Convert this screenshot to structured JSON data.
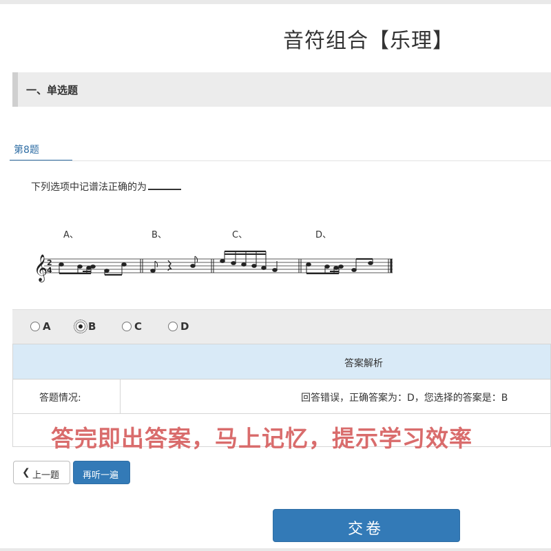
{
  "page": {
    "title": "音符组合【乐理】"
  },
  "section": {
    "title": "一、单选题"
  },
  "question": {
    "tab_label": "第8题",
    "text": "下列选项中记谱法正确的为",
    "option_labels": [
      "A、",
      "B、",
      "C、",
      "D、"
    ],
    "time_signature": {
      "top": "2",
      "bottom": "4"
    }
  },
  "answers": {
    "options": [
      {
        "label": "A",
        "checked": false
      },
      {
        "label": "B",
        "checked": true
      },
      {
        "label": "C",
        "checked": false
      },
      {
        "label": "D",
        "checked": false
      }
    ],
    "selected": "B"
  },
  "analysis": {
    "header": "答案解析",
    "result_label": "答题情况:",
    "result_value": "回答错误，正确答案为：D，您选择的答案是：B"
  },
  "promo_text": "答完即出答案，马上记忆，提示学习效率",
  "buttons": {
    "prev_label": "上一题",
    "replay_label": "再听一遍",
    "submit_label": "交卷"
  },
  "colors": {
    "primary": "#337ab7",
    "promo": "#d96c6c",
    "analysis_header_bg": "#d9eaf7",
    "bar_bg": "#ececec"
  },
  "icons": {
    "prev": "chevron-left-icon"
  }
}
